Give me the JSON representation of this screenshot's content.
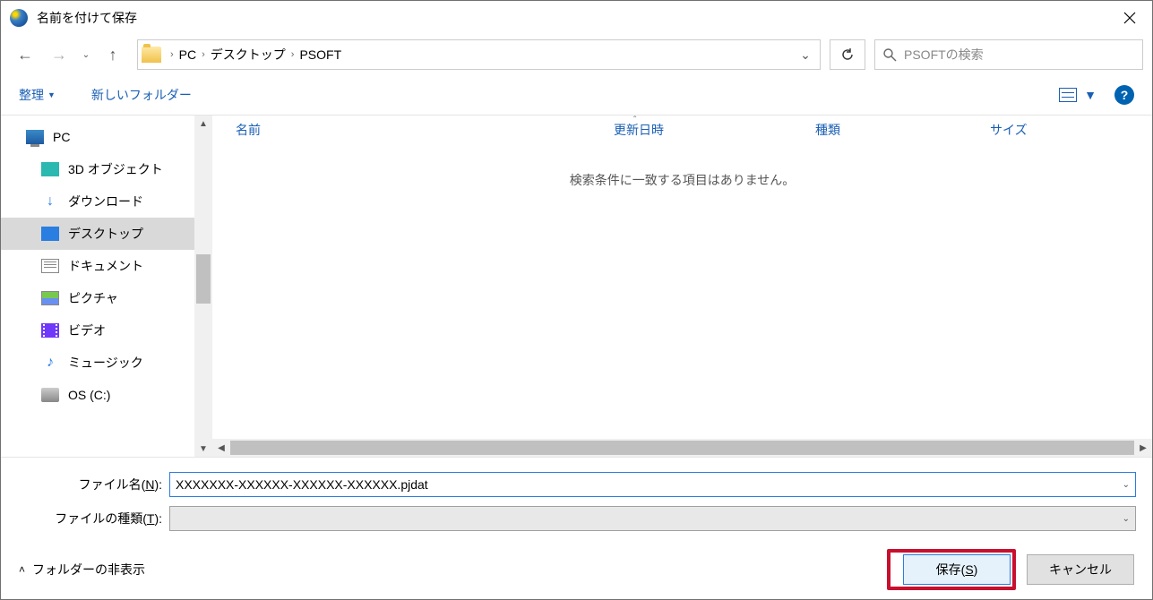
{
  "title": "名前を付けて保存",
  "breadcrumbs": {
    "root": "PC",
    "mid": "デスクトップ",
    "leaf": "PSOFT"
  },
  "search": {
    "placeholder": "PSOFTの検索"
  },
  "toolbar": {
    "organize": "整理",
    "newfolder": "新しいフォルダー"
  },
  "columns": {
    "name": "名前",
    "date": "更新日時",
    "type": "種類",
    "size": "サイズ"
  },
  "empty_message": "検索条件に一致する項目はありません。",
  "tree": {
    "pc": "PC",
    "items": [
      "3D オブジェクト",
      "ダウンロード",
      "デスクトップ",
      "ドキュメント",
      "ピクチャ",
      "ビデオ",
      "ミュージック",
      "OS (C:)"
    ]
  },
  "filename": {
    "label_pre": "ファイル名(",
    "label_u": "N",
    "label_post": "):",
    "value": "XXXXXXX-XXXXXX-XXXXXX-XXXXXX.pjdat"
  },
  "filetype": {
    "label_pre": "ファイルの種類(",
    "label_u": "T",
    "label_post": "):",
    "value": ""
  },
  "footer": {
    "hide": "フォルダーの非表示",
    "save_pre": "保存(",
    "save_u": "S",
    "save_post": ")",
    "cancel": "キャンセル"
  }
}
